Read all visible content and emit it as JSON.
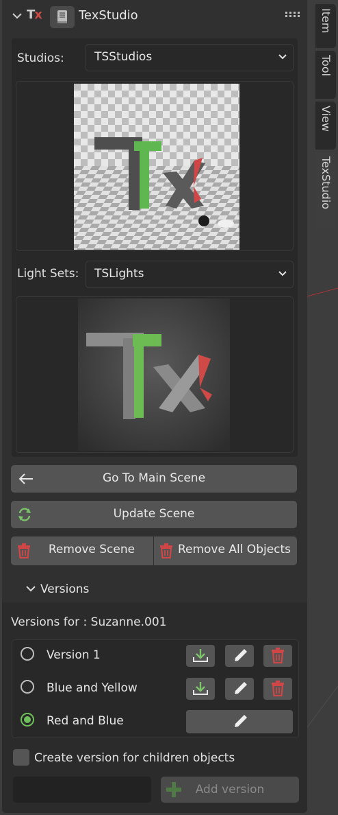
{
  "panel": {
    "title": "TexStudio",
    "logo_text": "Tx"
  },
  "studio": {
    "label": "Studios:",
    "selected": "TSStudios"
  },
  "lights": {
    "label": "Light Sets:",
    "selected": "TSLights"
  },
  "buttons": {
    "go_main": "Go To Main Scene",
    "update": "Update Scene",
    "remove_scene": "Remove Scene",
    "remove_all": "Remove All Objects"
  },
  "versions": {
    "section_title": "Versions",
    "for_label": "Versions for : Suzanne.001",
    "items": [
      {
        "label": "Version 1",
        "active": false
      },
      {
        "label": "Blue and Yellow",
        "active": false
      },
      {
        "label": "Red and Blue",
        "active": true
      }
    ],
    "create_children_label": "Create version for children objects",
    "create_children_checked": false,
    "name_input_value": "",
    "add_label": "Add version"
  },
  "sidebar_tabs": [
    "Item",
    "Tool",
    "View",
    "TexStudio"
  ],
  "sidebar_active_tab": "TexStudio",
  "colors": {
    "accent_green": "#6fbf5a",
    "delete_red": "#d04646",
    "logo_red": "#cf4a46"
  }
}
